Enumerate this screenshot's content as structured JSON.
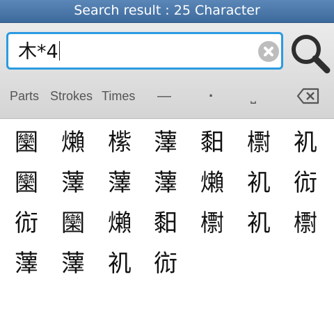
{
  "title": "Search result : 25 Character",
  "search": {
    "value": "木*4",
    "clear_icon": "clear-x-icon",
    "button_icon": "magnifier-icon"
  },
  "toolbar": {
    "parts": "Parts",
    "strokes": "Strokes",
    "times": "Times",
    "dash": "—",
    "dot": "·",
    "space": "⎵",
    "backspace_icon": "backspace-icon"
  },
  "results": [
    "圞",
    "㸊",
    "橴",
    "䕪",
    "䵒",
    "㯹",
    "䘛",
    "圞",
    "䕪",
    "䕪",
    "䕪",
    "㸊",
    "䘛",
    "䘕",
    "䘕",
    "圞",
    "㸊",
    "䵒",
    "㯹",
    "䘛",
    "㯹",
    "䕪",
    "䕪",
    "䘛",
    "䘕"
  ],
  "colors": {
    "titlebar": "#4a77ab",
    "accent": "#2a9be0"
  }
}
